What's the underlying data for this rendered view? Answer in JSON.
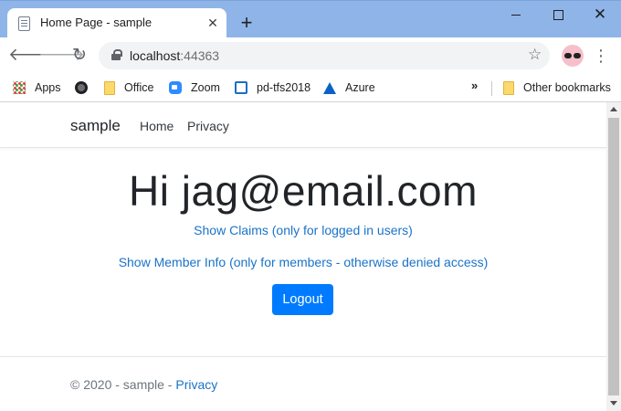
{
  "browser": {
    "tab_title": "Home Page - sample",
    "tab_close_glyph": "✕",
    "new_tab_glyph": "+",
    "window_close_glyph": "✕",
    "url_host": "localhost",
    "url_port": ":44363",
    "bookmarks": [
      {
        "label": "Apps",
        "icon": "apps-grid-icon"
      },
      {
        "label": "",
        "icon": "globe-icon"
      },
      {
        "label": "Office",
        "icon": "folder-icon"
      },
      {
        "label": "Zoom",
        "icon": "zoom-icon"
      },
      {
        "label": "pd-tfs2018",
        "icon": "azure-devops-icon"
      },
      {
        "label": "Azure",
        "icon": "azure-icon"
      },
      {
        "label": "Other bookmarks",
        "icon": "folder-icon"
      }
    ],
    "bookmarks_overflow": "»"
  },
  "site": {
    "brand": "sample",
    "nav": {
      "home": "Home",
      "privacy": "Privacy"
    },
    "greeting": "Hi jag@email.com",
    "show_claims": "Show Claims (only for logged in users)",
    "show_member": "Show Member Info (only for members - otherwise denied access)",
    "logout": "Logout",
    "footer_text": "© 2020 - sample - ",
    "footer_link": "Privacy"
  },
  "colors": {
    "titlebar": "#8fb4e8",
    "link": "#1a73c8",
    "primary_button": "#007bff"
  }
}
